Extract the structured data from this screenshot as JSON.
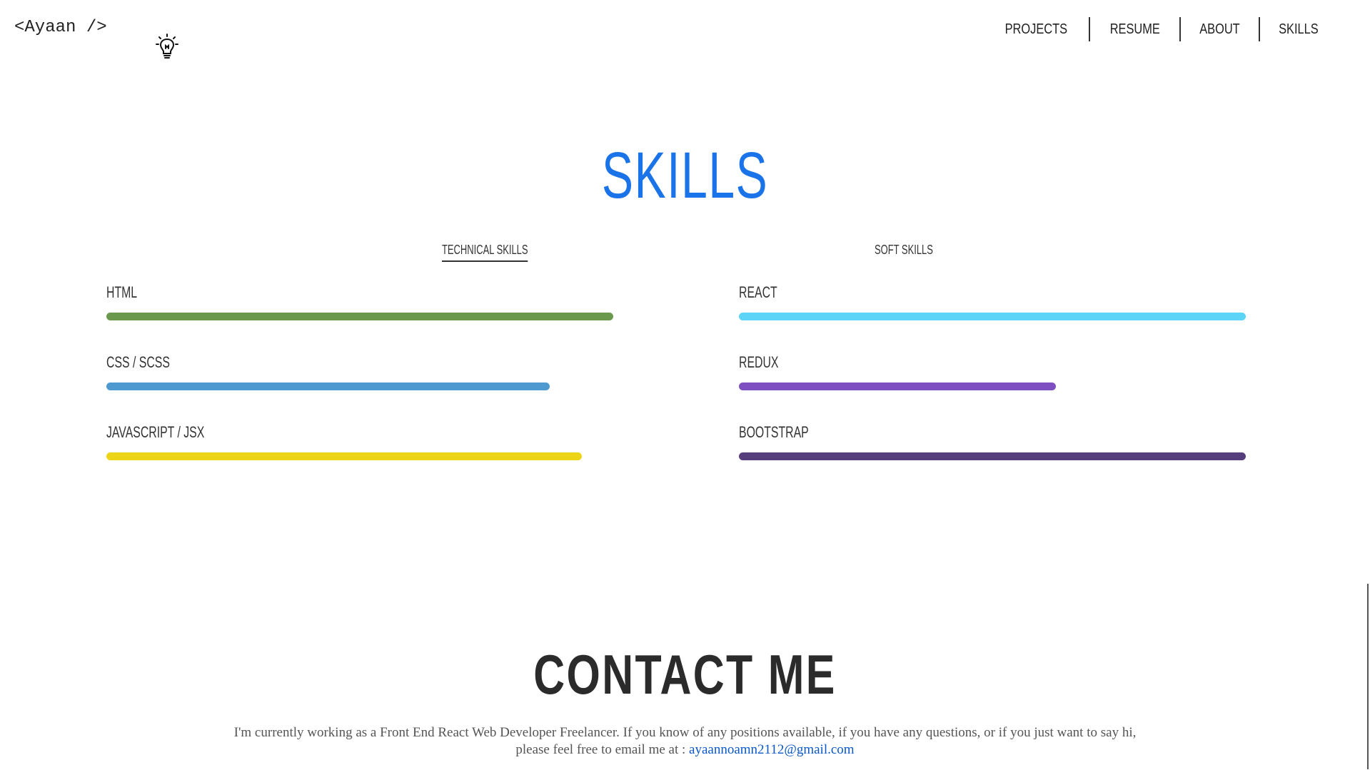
{
  "header": {
    "logo_text": "<Ayaan />",
    "logo_icon": "lightbulb-icon",
    "nav": [
      {
        "label": "PROJECTS"
      },
      {
        "label": "RESUME"
      },
      {
        "label": "ABOUT"
      },
      {
        "label": "SKILLS"
      }
    ]
  },
  "skills": {
    "title": "SKILLS",
    "tabs": [
      {
        "label": "TECHNICAL SKILLS",
        "active": true
      },
      {
        "label": "SOFT SKILLS",
        "active": false
      }
    ],
    "left": [
      {
        "label": "HTML",
        "level": 1.0,
        "color": "#6a994e"
      },
      {
        "label": "CSS / SCSS",
        "level": 0.875,
        "color": "#4e9ad0"
      },
      {
        "label": "JAVASCRIPT / JSX",
        "level": 0.9375,
        "color": "#ecd516"
      }
    ],
    "right": [
      {
        "label": "REACT",
        "level": 1.0,
        "color": "#5bd4f7"
      },
      {
        "label": "REDUX",
        "level": 0.625,
        "color": "#7e4fc1"
      },
      {
        "label": "BOOTSTRAP",
        "level": 1.0,
        "color": "#563d7c"
      }
    ]
  },
  "contact": {
    "title": "CONTACT ME",
    "line1": "I'm currently working as a Front End React Web Developer Freelancer. If you know of any positions available, if you have any questions, or if you just want to say hi,",
    "line2_prefix": "please feel free to email me at : ",
    "email": "ayaannoamn2112@gmail.com"
  },
  "colors": {
    "accent": "#1a73e8",
    "link": "#0a58ca"
  }
}
